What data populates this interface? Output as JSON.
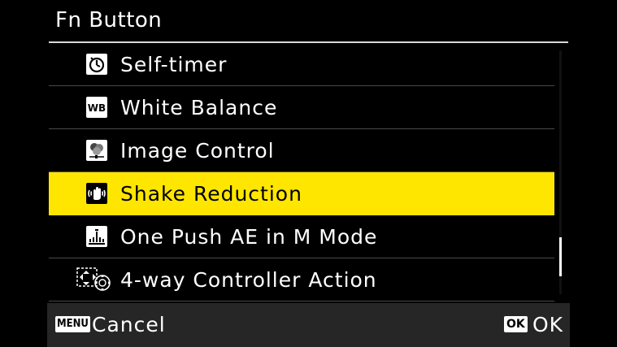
{
  "header": {
    "title": "Fn Button"
  },
  "menu": {
    "items": [
      {
        "label": "Self-timer",
        "icon": "self-timer-icon",
        "selected": false
      },
      {
        "label": "White Balance",
        "icon": "white-balance-icon",
        "selected": false
      },
      {
        "label": "Image Control",
        "icon": "image-control-icon",
        "selected": false
      },
      {
        "label": "Shake Reduction",
        "icon": "shake-reduction-icon",
        "selected": true
      },
      {
        "label": "One Push AE in M Mode",
        "icon": "one-push-ae-icon",
        "selected": false
      },
      {
        "label": "4-way Controller Action",
        "icon": "four-way-controller-icon",
        "selected": false
      }
    ]
  },
  "footer": {
    "menu_badge": "MENU",
    "cancel_label": "Cancel",
    "ok_badge": "OK",
    "ok_label": "OK"
  },
  "wb_badge": "WB",
  "colors": {
    "highlight": "#ffe600",
    "background": "#000000",
    "footer": "#262626",
    "divider": "#4a4a4a"
  }
}
